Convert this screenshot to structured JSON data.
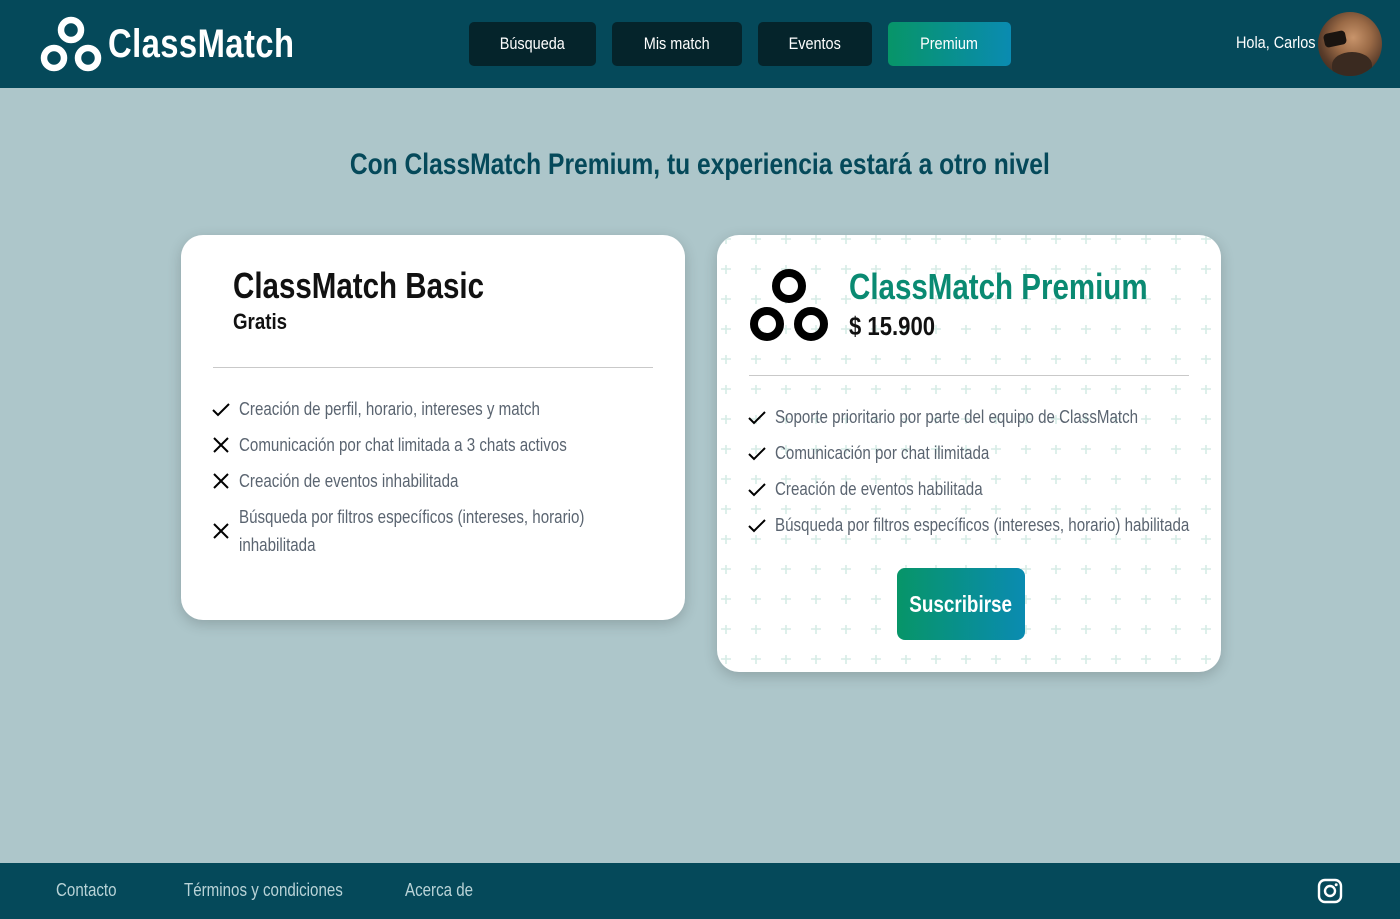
{
  "header": {
    "brand": "ClassMatch",
    "nav": [
      {
        "label": "Búsqueda"
      },
      {
        "label": "Mis match"
      },
      {
        "label": "Eventos"
      },
      {
        "label": "Premium",
        "active": true
      }
    ],
    "greeting": "Hola, Carlos",
    "avatar_icon": "user-avatar"
  },
  "main": {
    "headline": "Con ClassMatch Premium, tu experiencia estará a otro nivel",
    "basic": {
      "title": "ClassMatch Basic",
      "price": "Gratis",
      "features": [
        {
          "icon": "check-icon",
          "text": "Creación de perfil, horario, intereses y match"
        },
        {
          "icon": "cross-icon",
          "text": "Comunicación por chat limitada a 3 chats activos"
        },
        {
          "icon": "cross-icon",
          "text": "Creación de eventos inhabilitada"
        },
        {
          "icon": "cross-icon",
          "text": "Búsqueda por filtros específicos (intereses, horario)",
          "text2": "inhabilitada"
        }
      ]
    },
    "premium": {
      "title": "ClassMatch Premium",
      "price": "$ 15.900",
      "logo_icon": "classmatch-logo-icon",
      "features": [
        {
          "icon": "check-icon",
          "text": "Soporte prioritario por parte del equipo de ClassMatch"
        },
        {
          "icon": "check-icon",
          "text": "Comunicación por chat ilimitada"
        },
        {
          "icon": "check-icon",
          "text": "Creación de eventos habilitada"
        },
        {
          "icon": "check-icon",
          "text": "Búsqueda por filtros específicos (intereses, horario) habilitada"
        }
      ],
      "cta": "Suscribirse"
    }
  },
  "footer": {
    "links": [
      {
        "label": "Contacto"
      },
      {
        "label": "Términos y condiciones"
      },
      {
        "label": "Acerca de"
      }
    ],
    "social_icon": "instagram-icon"
  },
  "colors": {
    "header_bg": "#05495a",
    "page_bg": "#adc6ca",
    "nav_btn_bg": "#05242b",
    "accent_green": "#079568",
    "accent_blue": "#0a8bb1",
    "premium_title": "#0a8a72"
  }
}
